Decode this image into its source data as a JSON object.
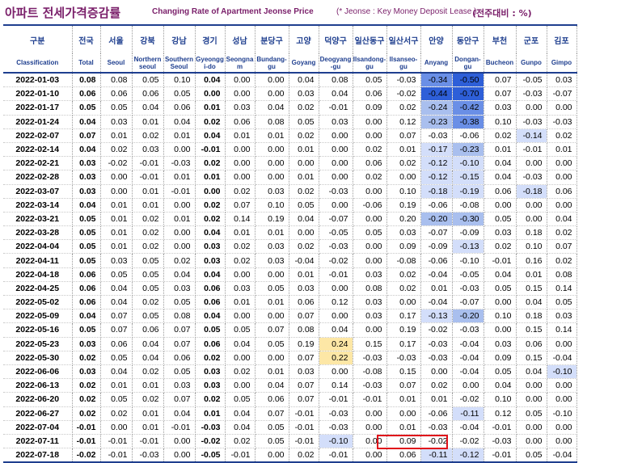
{
  "title": {
    "korean": "아파트 전세가격증감률",
    "english": "Changing Rate of Apartment Jeonse Price",
    "note": "(* Jeonse : Key Money Deposit Lease )",
    "unit": "(전주대비 : %)"
  },
  "columns": [
    {
      "ko": "구분",
      "en": "Classification"
    },
    {
      "ko": "전국",
      "en": "Total"
    },
    {
      "ko": "서울",
      "en": "Seoul"
    },
    {
      "ko": "강북",
      "en": "Northern seoul"
    },
    {
      "ko": "강남",
      "en": "Southern Seoul"
    },
    {
      "ko": "경기",
      "en": "Gyeongg i-do"
    },
    {
      "ko": "성남",
      "en": "Seongna m"
    },
    {
      "ko": "분당구",
      "en": "Bundang-gu"
    },
    {
      "ko": "고양",
      "en": "Goyang"
    },
    {
      "ko": "덕양구",
      "en": "Deogyang -gu"
    },
    {
      "ko": "일산동구",
      "en": "Ilsandong-gu"
    },
    {
      "ko": "일산서구",
      "en": "Ilsanseo-gu"
    },
    {
      "ko": "안양",
      "en": "Anyang"
    },
    {
      "ko": "동안구",
      "en": "Dongan-gu"
    },
    {
      "ko": "부천",
      "en": "Bucheon"
    },
    {
      "ko": "군포",
      "en": "Gunpo"
    },
    {
      "ko": "김포",
      "en": "Gimpo"
    }
  ],
  "rows": [
    {
      "date": "2022-01-03",
      "values": [
        "0.08",
        "0.08",
        "0.05",
        "0.10",
        "0.04",
        "0.00",
        "0.00",
        "0.04",
        "0.08",
        "0.05",
        "-0.03",
        "-0.34",
        "-0.50",
        "0.07",
        "-0.05",
        "0.03"
      ]
    },
    {
      "date": "2022-01-10",
      "values": [
        "0.06",
        "0.06",
        "0.06",
        "0.05",
        "0.00",
        "0.00",
        "0.00",
        "0.03",
        "0.04",
        "0.06",
        "-0.02",
        "-0.44",
        "-0.70",
        "0.07",
        "-0.03",
        "-0.07"
      ]
    },
    {
      "date": "2022-01-17",
      "values": [
        "0.05",
        "0.05",
        "0.04",
        "0.06",
        "0.01",
        "0.03",
        "0.04",
        "0.02",
        "-0.01",
        "0.09",
        "0.02",
        "-0.24",
        "-0.42",
        "0.03",
        "0.00",
        "0.00"
      ]
    },
    {
      "date": "2022-01-24",
      "values": [
        "0.04",
        "0.03",
        "0.01",
        "0.04",
        "0.02",
        "0.06",
        "0.08",
        "0.05",
        "0.03",
        "0.00",
        "0.12",
        "-0.23",
        "-0.38",
        "0.10",
        "-0.03",
        "-0.03"
      ]
    },
    {
      "date": "2022-02-07",
      "values": [
        "0.07",
        "0.01",
        "0.02",
        "0.01",
        "0.04",
        "0.01",
        "0.01",
        "0.02",
        "0.00",
        "0.00",
        "0.07",
        "-0.03",
        "-0.06",
        "0.02",
        "-0.14",
        "0.02"
      ]
    },
    {
      "date": "2022-02-14",
      "values": [
        "0.04",
        "0.02",
        "0.03",
        "0.00",
        "-0.01",
        "0.00",
        "0.00",
        "0.01",
        "0.00",
        "0.02",
        "0.01",
        "-0.17",
        "-0.23",
        "0.01",
        "-0.01",
        "0.01"
      ]
    },
    {
      "date": "2022-02-21",
      "values": [
        "0.03",
        "-0.02",
        "-0.01",
        "-0.03",
        "0.02",
        "0.00",
        "0.00",
        "0.00",
        "0.00",
        "0.06",
        "0.02",
        "-0.12",
        "-0.10",
        "0.04",
        "0.00",
        "0.00"
      ]
    },
    {
      "date": "2022-02-28",
      "values": [
        "0.03",
        "0.00",
        "-0.01",
        "0.01",
        "0.01",
        "0.00",
        "0.00",
        "0.01",
        "0.00",
        "0.02",
        "0.00",
        "-0.12",
        "-0.15",
        "0.04",
        "-0.03",
        "0.00"
      ]
    },
    {
      "date": "2022-03-07",
      "values": [
        "0.03",
        "0.00",
        "0.01",
        "-0.01",
        "0.00",
        "0.02",
        "0.03",
        "0.02",
        "-0.03",
        "0.00",
        "0.10",
        "-0.18",
        "-0.19",
        "0.06",
        "-0.18",
        "0.06"
      ]
    },
    {
      "date": "2022-03-14",
      "values": [
        "0.04",
        "0.01",
        "0.01",
        "0.00",
        "0.02",
        "0.07",
        "0.10",
        "0.05",
        "0.00",
        "-0.06",
        "0.19",
        "-0.06",
        "-0.08",
        "0.00",
        "0.00",
        "0.00"
      ]
    },
    {
      "date": "2022-03-21",
      "values": [
        "0.05",
        "0.01",
        "0.02",
        "0.01",
        "0.02",
        "0.14",
        "0.19",
        "0.04",
        "-0.07",
        "0.00",
        "0.20",
        "-0.20",
        "-0.30",
        "0.05",
        "0.00",
        "0.04"
      ]
    },
    {
      "date": "2022-03-28",
      "values": [
        "0.05",
        "0.01",
        "0.02",
        "0.00",
        "0.04",
        "0.01",
        "0.01",
        "0.00",
        "-0.05",
        "0.05",
        "0.03",
        "-0.07",
        "-0.09",
        "0.03",
        "0.18",
        "0.02"
      ]
    },
    {
      "date": "2022-04-04",
      "values": [
        "0.05",
        "0.01",
        "0.02",
        "0.00",
        "0.03",
        "0.02",
        "0.03",
        "0.02",
        "-0.03",
        "0.00",
        "0.09",
        "-0.09",
        "-0.13",
        "0.02",
        "0.10",
        "0.07"
      ]
    },
    {
      "date": "2022-04-11",
      "values": [
        "0.05",
        "0.03",
        "0.05",
        "0.02",
        "0.03",
        "0.02",
        "0.03",
        "-0.04",
        "-0.02",
        "0.00",
        "-0.08",
        "-0.06",
        "-0.10",
        "-0.01",
        "0.16",
        "0.02"
      ]
    },
    {
      "date": "2022-04-18",
      "values": [
        "0.06",
        "0.05",
        "0.05",
        "0.04",
        "0.04",
        "0.00",
        "0.00",
        "0.01",
        "-0.01",
        "0.03",
        "0.02",
        "-0.04",
        "-0.05",
        "0.04",
        "0.01",
        "0.08"
      ]
    },
    {
      "date": "2022-04-25",
      "values": [
        "0.06",
        "0.04",
        "0.05",
        "0.03",
        "0.06",
        "0.03",
        "0.05",
        "0.03",
        "0.00",
        "0.08",
        "0.02",
        "0.01",
        "-0.03",
        "0.05",
        "0.15",
        "0.14"
      ]
    },
    {
      "date": "2022-05-02",
      "values": [
        "0.06",
        "0.04",
        "0.02",
        "0.05",
        "0.06",
        "0.01",
        "0.01",
        "0.06",
        "0.12",
        "0.03",
        "0.00",
        "-0.04",
        "-0.07",
        "0.00",
        "0.04",
        "0.05"
      ]
    },
    {
      "date": "2022-05-09",
      "values": [
        "0.04",
        "0.07",
        "0.05",
        "0.08",
        "0.04",
        "0.00",
        "0.00",
        "0.07",
        "0.00",
        "0.03",
        "0.17",
        "-0.13",
        "-0.20",
        "0.10",
        "0.18",
        "0.03"
      ]
    },
    {
      "date": "2022-05-16",
      "values": [
        "0.05",
        "0.07",
        "0.06",
        "0.07",
        "0.05",
        "0.05",
        "0.07",
        "0.08",
        "0.04",
        "0.00",
        "0.19",
        "-0.02",
        "-0.03",
        "0.00",
        "0.15",
        "0.14"
      ]
    },
    {
      "date": "2022-05-23",
      "values": [
        "0.03",
        "0.06",
        "0.04",
        "0.07",
        "0.06",
        "0.04",
        "0.05",
        "0.19",
        "0.24",
        "0.15",
        "0.17",
        "-0.03",
        "-0.04",
        "0.03",
        "0.06",
        "0.00"
      ]
    },
    {
      "date": "2022-05-30",
      "values": [
        "0.02",
        "0.05",
        "0.04",
        "0.06",
        "0.02",
        "0.00",
        "0.00",
        "0.07",
        "0.22",
        "-0.03",
        "-0.03",
        "-0.03",
        "-0.04",
        "0.09",
        "0.15",
        "-0.04"
      ]
    },
    {
      "date": "2022-06-06",
      "values": [
        "0.03",
        "0.04",
        "0.02",
        "0.05",
        "0.03",
        "0.02",
        "0.01",
        "0.03",
        "0.00",
        "-0.08",
        "0.15",
        "0.00",
        "-0.04",
        "0.05",
        "0.04",
        "-0.10"
      ]
    },
    {
      "date": "2022-06-13",
      "values": [
        "0.02",
        "0.01",
        "0.01",
        "0.03",
        "0.03",
        "0.00",
        "0.04",
        "0.07",
        "0.14",
        "-0.03",
        "0.07",
        "0.02",
        "0.00",
        "0.04",
        "0.00",
        "0.00"
      ]
    },
    {
      "date": "2022-06-20",
      "values": [
        "0.02",
        "0.05",
        "0.02",
        "0.07",
        "0.02",
        "0.05",
        "0.06",
        "0.07",
        "-0.01",
        "-0.01",
        "0.01",
        "0.01",
        "-0.02",
        "0.10",
        "0.00",
        "0.00"
      ]
    },
    {
      "date": "2022-06-27",
      "values": [
        "0.02",
        "0.02",
        "0.01",
        "0.04",
        "0.01",
        "0.04",
        "0.07",
        "-0.01",
        "-0.03",
        "0.00",
        "0.00",
        "-0.06",
        "-0.11",
        "0.12",
        "0.05",
        "-0.10"
      ]
    },
    {
      "date": "2022-07-04",
      "values": [
        "-0.01",
        "0.00",
        "0.01",
        "-0.01",
        "-0.03",
        "0.04",
        "0.05",
        "-0.01",
        "-0.03",
        "0.00",
        "0.01",
        "-0.03",
        "-0.04",
        "-0.01",
        "0.00",
        "0.00"
      ]
    },
    {
      "date": "2022-07-11",
      "values": [
        "-0.01",
        "-0.01",
        "-0.01",
        "0.00",
        "-0.02",
        "0.02",
        "0.05",
        "-0.01",
        "-0.10",
        "0.00",
        "0.09",
        "-0.02",
        "-0.02",
        "-0.03",
        "0.00",
        "0.00"
      ]
    },
    {
      "date": "2022-07-18",
      "values": [
        "-0.02",
        "-0.01",
        "-0.03",
        "0.00",
        "-0.05",
        "-0.01",
        "0.00",
        "0.02",
        "-0.01",
        "0.00",
        "0.06",
        "-0.11",
        "-0.12",
        "-0.01",
        "0.05",
        "-0.04"
      ]
    }
  ],
  "shading": [
    {
      "row": 0,
      "col": 11,
      "level": "mid"
    },
    {
      "row": 0,
      "col": 12,
      "level": "dark"
    },
    {
      "row": 1,
      "col": 11,
      "level": "dark"
    },
    {
      "row": 1,
      "col": 12,
      "level": "dark"
    },
    {
      "row": 2,
      "col": 11,
      "level": "light"
    },
    {
      "row": 2,
      "col": 12,
      "level": "mid"
    },
    {
      "row": 3,
      "col": 11,
      "level": "light"
    },
    {
      "row": 3,
      "col": 12,
      "level": "mid"
    },
    {
      "row": 4,
      "col": 14,
      "level": "pale"
    },
    {
      "row": 5,
      "col": 11,
      "level": "pale"
    },
    {
      "row": 5,
      "col": 12,
      "level": "light"
    },
    {
      "row": 6,
      "col": 11,
      "level": "pale"
    },
    {
      "row": 6,
      "col": 12,
      "level": "pale"
    },
    {
      "row": 7,
      "col": 11,
      "level": "pale"
    },
    {
      "row": 7,
      "col": 12,
      "level": "pale"
    },
    {
      "row": 8,
      "col": 11,
      "level": "pale"
    },
    {
      "row": 8,
      "col": 12,
      "level": "pale"
    },
    {
      "row": 8,
      "col": 14,
      "level": "pale"
    },
    {
      "row": 10,
      "col": 11,
      "level": "light"
    },
    {
      "row": 10,
      "col": 12,
      "level": "light"
    },
    {
      "row": 12,
      "col": 12,
      "level": "pale"
    },
    {
      "row": 17,
      "col": 11,
      "level": "pale"
    },
    {
      "row": 17,
      "col": 12,
      "level": "light"
    },
    {
      "row": 19,
      "col": 8,
      "level": "yellow"
    },
    {
      "row": 20,
      "col": 8,
      "level": "yellow"
    },
    {
      "row": 21,
      "col": 15,
      "level": "pale"
    },
    {
      "row": 24,
      "col": 12,
      "level": "pale"
    },
    {
      "row": 26,
      "col": 8,
      "level": "pale"
    },
    {
      "row": 27,
      "col": 11,
      "level": "pale"
    },
    {
      "row": 27,
      "col": 12,
      "level": "pale"
    }
  ],
  "highlight_box": {
    "row": 27,
    "cols": [
      9,
      10
    ],
    "color": "#e0101a"
  }
}
